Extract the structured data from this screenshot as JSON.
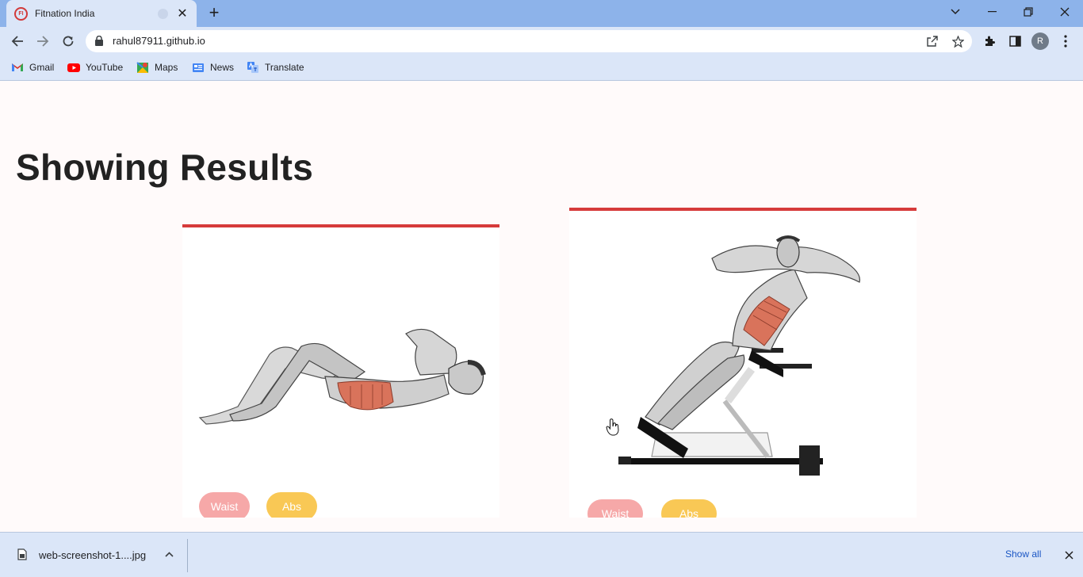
{
  "browser": {
    "tab": {
      "title": "Fitnation India",
      "favicon_text": "FI"
    },
    "address_bar": {
      "url": "rahul87911.github.io"
    },
    "profile_initial": "R",
    "bookmarks": [
      {
        "label": "Gmail",
        "icon": "gmail-icon"
      },
      {
        "label": "YouTube",
        "icon": "youtube-icon"
      },
      {
        "label": "Maps",
        "icon": "maps-icon"
      },
      {
        "label": "News",
        "icon": "news-icon"
      },
      {
        "label": "Translate",
        "icon": "translate-icon"
      }
    ]
  },
  "page": {
    "heading": "Showing Results",
    "cards": [
      {
        "exercise": "crunch",
        "tags": [
          "Waist",
          "Abs"
        ]
      },
      {
        "exercise": "roman-chair-sit-up",
        "tags": [
          "Waist",
          "Abs"
        ]
      }
    ],
    "colors": {
      "card_border": "#d63a3a",
      "waist_tag": "#f6a8a8",
      "abs_tag": "#f9c855"
    }
  },
  "downloads": {
    "file_name": "web-screenshot-1....jpg",
    "show_all": "Show all"
  }
}
